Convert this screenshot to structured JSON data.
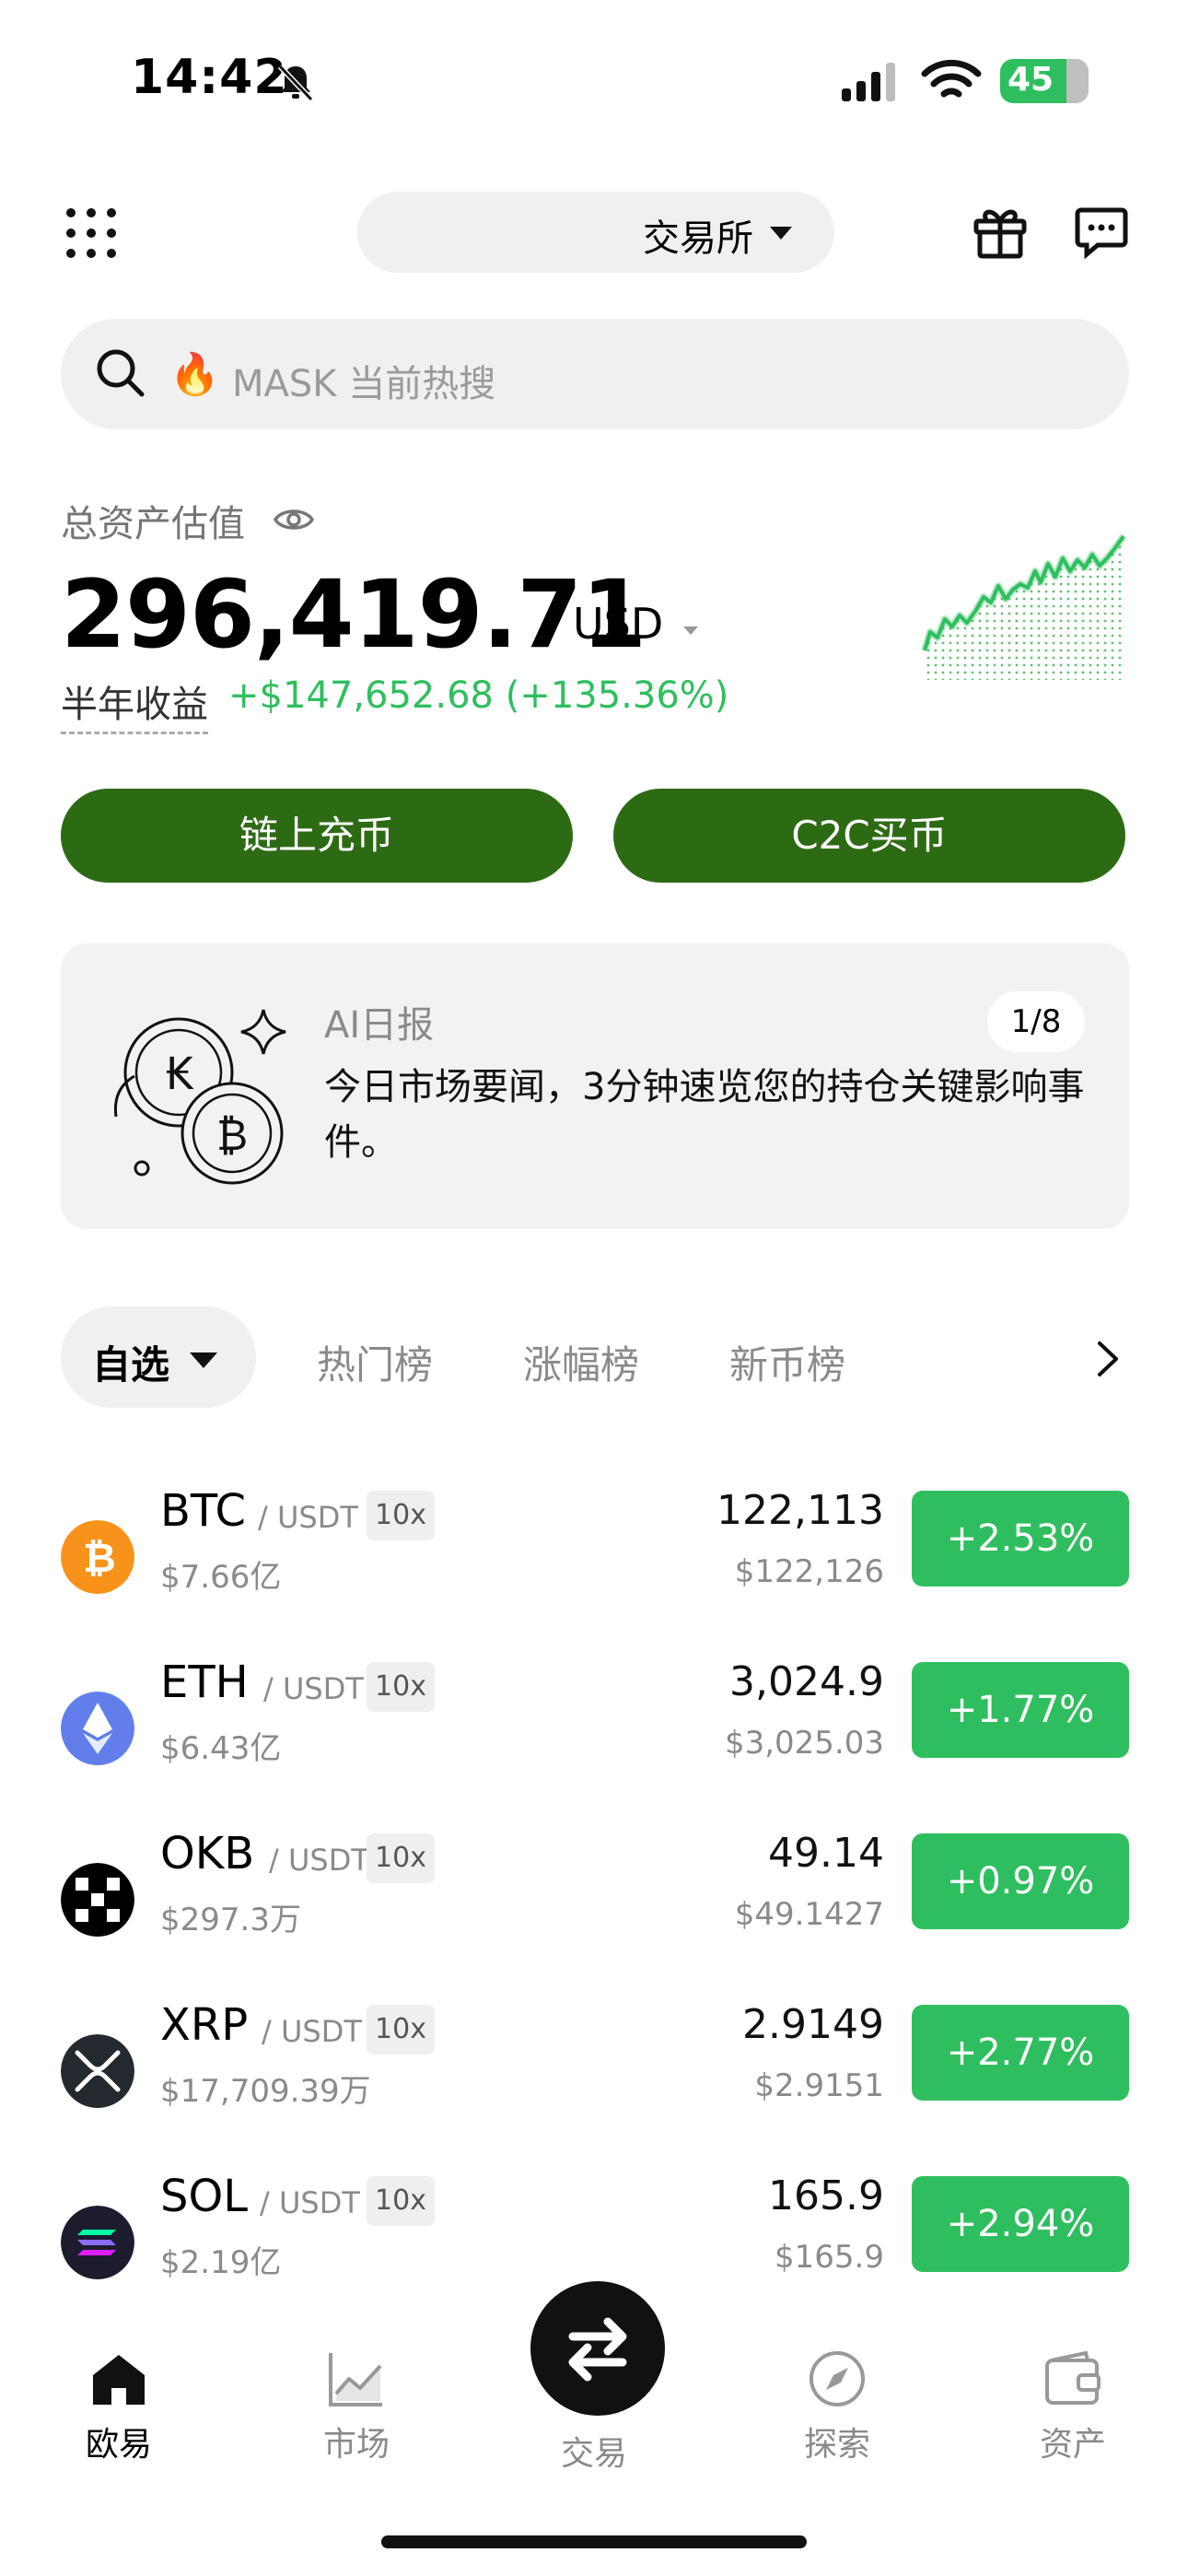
{
  "status_bar": {
    "time": "14:42",
    "battery": "45"
  },
  "header": {
    "exchange_label": "交易所"
  },
  "search": {
    "placeholder": "MASK 当前热搜",
    "fire": "🔥"
  },
  "assets": {
    "label": "总资产估值",
    "amount": "296,419.71",
    "currency": "USD",
    "pnl_label": "半年收益",
    "pnl_value": "+$147,652.68 (+135.36%)"
  },
  "actions": {
    "deposit": "链上充币",
    "c2c": "C2C买币"
  },
  "ai_report": {
    "title": "AI日报",
    "body": "今日市场要闻，3分钟速览您的持仓关键影响事件。",
    "pager": "1/8"
  },
  "tabs": {
    "selected": "自选",
    "items": [
      "热门榜",
      "涨幅榜",
      "新币榜"
    ]
  },
  "coins": [
    {
      "symbol": "BTC",
      "pair": "/ USDT",
      "leverage": "10x",
      "volume": "$7.66亿",
      "price": "122,113",
      "usd": "$122,126",
      "change": "+2.53%",
      "icon": "bitcoin-icon",
      "color": "#f7931a"
    },
    {
      "symbol": "ETH",
      "pair": "/ USDT",
      "leverage": "10x",
      "volume": "$6.43亿",
      "price": "3,024.9",
      "usd": "$3,025.03",
      "change": "+1.77%",
      "icon": "ethereum-icon",
      "color": "#627eea"
    },
    {
      "symbol": "OKB",
      "pair": "/ USDT",
      "leverage": "10x",
      "volume": "$297.3万",
      "price": "49.14",
      "usd": "$49.1427",
      "change": "+0.97%",
      "icon": "okb-icon",
      "color": "#000000"
    },
    {
      "symbol": "XRP",
      "pair": "/ USDT",
      "leverage": "10x",
      "volume": "$17,709.39万",
      "price": "2.9149",
      "usd": "$2.9151",
      "change": "+2.77%",
      "icon": "xrp-icon",
      "color": "#23292f"
    },
    {
      "symbol": "SOL",
      "pair": "/ USDT",
      "leverage": "10x",
      "volume": "$2.19亿",
      "price": "165.9",
      "usd": "$165.9",
      "change": "+2.94%",
      "icon": "solana-icon",
      "color": "#1c1c2e"
    }
  ],
  "nav": {
    "home": "欧易",
    "market": "市场",
    "trade": "交易",
    "explore": "探索",
    "assets": "资产"
  },
  "colors": {
    "brand_green": "#2d6a14",
    "up_green": "#2fbe5f"
  }
}
